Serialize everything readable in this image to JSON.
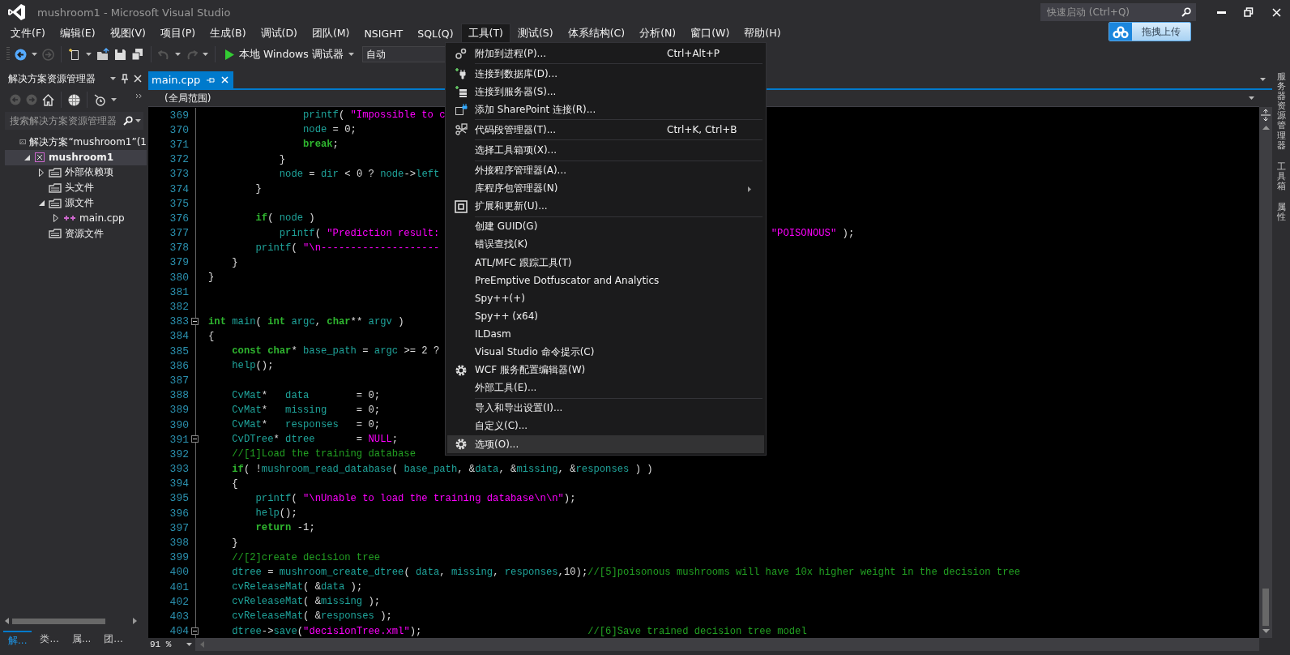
{
  "window": {
    "title": "mushroom1 - Microsoft Visual Studio",
    "quick_launch": {
      "placeholder": "快速启动 (Ctrl+Q)"
    }
  },
  "upload_button": {
    "label": "拖拽上传"
  },
  "menu_bar": [
    {
      "label": "文件(F)",
      "selected": false
    },
    {
      "label": "编辑(E)",
      "selected": false
    },
    {
      "label": "视图(V)",
      "selected": false
    },
    {
      "label": "项目(P)",
      "selected": false
    },
    {
      "label": "生成(B)",
      "selected": false
    },
    {
      "label": "调试(D)",
      "selected": false
    },
    {
      "label": "团队(M)",
      "selected": false
    },
    {
      "label": "NSIGHT",
      "selected": false
    },
    {
      "label": "SQL(Q)",
      "selected": false
    },
    {
      "label": "工具(T)",
      "selected": true
    },
    {
      "label": "测试(S)",
      "selected": false
    },
    {
      "label": "体系结构(C)",
      "selected": false
    },
    {
      "label": "分析(N)",
      "selected": false
    },
    {
      "label": "窗口(W)",
      "selected": false
    },
    {
      "label": "帮助(H)",
      "selected": false
    }
  ],
  "toolbar": {
    "debugger": "本地 Windows 调试器",
    "configuration": "自动"
  },
  "tools_menu": {
    "groups": [
      [
        {
          "label": "附加到进程(P)...",
          "shortcut": "Ctrl+Alt+P",
          "kind": "gears",
          "submenu": false,
          "selected": false
        }
      ],
      [
        {
          "label": "连接到数据库(D)...",
          "kind": "plug",
          "submenu": false,
          "selected": false
        },
        {
          "label": "连接到服务器(S)...",
          "kind": "server",
          "submenu": false,
          "selected": false
        },
        {
          "label": "添加 SharePoint 连接(R)...",
          "kind": "page",
          "submenu": false,
          "selected": false
        }
      ],
      [
        {
          "label": "代码段管理器(T)...",
          "shortcut": "Ctrl+K, Ctrl+B",
          "kind": "scissors",
          "submenu": false,
          "selected": false
        }
      ],
      [
        {
          "label": "选择工具箱项(X)...",
          "kind": "plain",
          "submenu": false,
          "selected": false
        }
      ],
      [
        {
          "label": "外接程序管理器(A)...",
          "kind": "plain",
          "submenu": false,
          "selected": false
        },
        {
          "label": "库程序包管理器(N)",
          "kind": "plain",
          "submenu": true,
          "selected": false
        },
        {
          "label": "扩展和更新(U)...",
          "kind": "blocks",
          "submenu": false,
          "selected": false
        }
      ],
      [
        {
          "label": "创建 GUID(G)",
          "kind": "plain",
          "submenu": false,
          "selected": false
        },
        {
          "label": "错误查找(K)",
          "kind": "plain",
          "submenu": false,
          "selected": false
        },
        {
          "label": "ATL/MFC 跟踪工具(T)",
          "kind": "plain",
          "submenu": false,
          "selected": false
        },
        {
          "label": "PreEmptive Dotfuscator and Analytics",
          "kind": "plain",
          "submenu": false,
          "selected": false
        },
        {
          "label": "Spy++(+)",
          "kind": "plain",
          "submenu": false,
          "selected": false
        },
        {
          "label": "Spy++ (x64)",
          "kind": "plain",
          "submenu": false,
          "selected": false
        },
        {
          "label": "ILDasm",
          "kind": "plain",
          "submenu": false,
          "selected": false
        },
        {
          "label": "Visual Studio 命令提示(C)",
          "kind": "plain",
          "submenu": false,
          "selected": false
        },
        {
          "label": "WCF 服务配置编辑器(W)",
          "kind": "gear",
          "submenu": false,
          "selected": false
        },
        {
          "label": "外部工具(E)...",
          "kind": "plain",
          "submenu": false,
          "selected": false
        }
      ],
      [
        {
          "label": "导入和导出设置(I)...",
          "kind": "plain",
          "submenu": false,
          "selected": false
        },
        {
          "label": "自定义(C)...",
          "kind": "plain",
          "submenu": false,
          "selected": false
        },
        {
          "label": "选项(O)...",
          "kind": "gear",
          "submenu": false,
          "selected": true
        }
      ]
    ]
  },
  "solution_explorer": {
    "title": "解决方案资源管理器",
    "search": {
      "placeholder": "搜索解决方案资源管理器"
    },
    "tree": [
      {
        "label": "解决方案“mushroom1”(1",
        "kind": "solution",
        "expandable": false,
        "selected": false,
        "children": [
          {
            "label": "mushroom1",
            "kind": "project",
            "expandable": true,
            "expanded": true,
            "selected": true,
            "children": [
              {
                "label": "外部依赖项",
                "kind": "folder",
                "expandable": true,
                "expanded": false,
                "selected": false
              },
              {
                "label": "头文件",
                "kind": "folder",
                "expandable": false,
                "selected": false
              },
              {
                "label": "源文件",
                "kind": "folder",
                "expandable": true,
                "expanded": true,
                "selected": false,
                "children": [
                  {
                    "label": "main.cpp",
                    "kind": "cpp",
                    "expandable": true,
                    "expanded": false,
                    "selected": false
                  }
                ]
              },
              {
                "label": "资源文件",
                "kind": "folder",
                "expandable": false,
                "selected": false
              }
            ]
          }
        ]
      }
    ],
    "bottom_tabs": [
      {
        "label": "解...",
        "selected": true
      },
      {
        "label": "类...",
        "selected": false
      },
      {
        "label": "属...",
        "selected": false
      },
      {
        "label": "团...",
        "selected": false
      }
    ]
  },
  "editor": {
    "tab": {
      "label": "main.cpp",
      "selected": true
    },
    "scope": "(全局范围)",
    "zoom": "91 %",
    "lines": [
      {
        "number": "369",
        "fold": false,
        "tokens": [
          {
            "text": "                printf",
            "kind": "id"
          },
          {
            "text": "( ",
            "kind": "p"
          },
          {
            "text": "\"Impossible to c",
            "kind": "str"
          }
        ]
      },
      {
        "number": "370",
        "fold": false,
        "tokens": [
          {
            "text": "                node",
            "kind": "id"
          },
          {
            "text": " = ",
            "kind": "p"
          },
          {
            "text": "0",
            "kind": "num"
          },
          {
            "text": ";",
            "kind": "p"
          }
        ]
      },
      {
        "number": "371",
        "fold": false,
        "tokens": [
          {
            "text": "                break",
            "kind": "kw"
          },
          {
            "text": ";",
            "kind": "p"
          }
        ]
      },
      {
        "number": "372",
        "fold": false,
        "tokens": [
          {
            "text": "            }",
            "kind": "p"
          }
        ]
      },
      {
        "number": "373",
        "fold": false,
        "tokens": [
          {
            "text": "            node",
            "kind": "id"
          },
          {
            "text": " = ",
            "kind": "p"
          },
          {
            "text": "dir",
            "kind": "id"
          },
          {
            "text": " < ",
            "kind": "p"
          },
          {
            "text": "0",
            "kind": "num"
          },
          {
            "text": " ? ",
            "kind": "p"
          },
          {
            "text": "node",
            "kind": "id"
          },
          {
            "text": "->",
            "kind": "p"
          },
          {
            "text": "left",
            "kind": "id"
          }
        ]
      },
      {
        "number": "374",
        "fold": false,
        "tokens": [
          {
            "text": "        }",
            "kind": "p"
          }
        ]
      },
      {
        "number": "375",
        "fold": false
      },
      {
        "number": "376",
        "fold": false,
        "tokens": [
          {
            "text": "        if",
            "kind": "kw"
          },
          {
            "text": "( ",
            "kind": "p"
          },
          {
            "text": "node",
            "kind": "id"
          },
          {
            "text": " )",
            "kind": "p"
          }
        ]
      },
      {
        "number": "377",
        "fold": false,
        "tokens": [
          {
            "text": "            printf",
            "kind": "id"
          },
          {
            "text": "( ",
            "kind": "p"
          },
          {
            "text": "\"Prediction result:",
            "kind": "str"
          }
        ],
        "after_menu": [
          {
            "text": "\"POISONOUS\"",
            "kind": "str"
          },
          {
            "text": " );",
            "kind": "p"
          }
        ]
      },
      {
        "number": "378",
        "fold": false,
        "tokens": [
          {
            "text": "        printf",
            "kind": "id"
          },
          {
            "text": "( ",
            "kind": "p"
          },
          {
            "text": "\"\\n--------------------",
            "kind": "str"
          }
        ]
      },
      {
        "number": "379",
        "fold": false,
        "tokens": [
          {
            "text": "    }",
            "kind": "p"
          }
        ]
      },
      {
        "number": "380",
        "fold": false,
        "tokens": [
          {
            "text": "}",
            "kind": "p"
          }
        ]
      },
      {
        "number": "381",
        "fold": false
      },
      {
        "number": "382",
        "fold": false
      },
      {
        "number": "383",
        "fold": true,
        "tokens": [
          {
            "text": "int",
            "kind": "kw"
          },
          {
            "text": " main",
            "kind": "id"
          },
          {
            "text": "( ",
            "kind": "p"
          },
          {
            "text": "int",
            "kind": "kw"
          },
          {
            "text": " argc",
            "kind": "id"
          },
          {
            "text": ", ",
            "kind": "p"
          },
          {
            "text": "char",
            "kind": "kw"
          },
          {
            "text": "** ",
            "kind": "p"
          },
          {
            "text": "argv",
            "kind": "id"
          },
          {
            "text": " )",
            "kind": "p"
          }
        ]
      },
      {
        "number": "384",
        "fold": false,
        "tokens": [
          {
            "text": "{",
            "kind": "p"
          }
        ]
      },
      {
        "number": "385",
        "fold": false,
        "tokens": [
          {
            "text": "    const",
            "kind": "kw"
          },
          {
            "text": " char",
            "kind": "kw"
          },
          {
            "text": "* ",
            "kind": "p"
          },
          {
            "text": "base_path",
            "kind": "id"
          },
          {
            "text": " = ",
            "kind": "p"
          },
          {
            "text": "argc",
            "kind": "id"
          },
          {
            "text": " >= ",
            "kind": "p"
          },
          {
            "text": "2",
            "kind": "num"
          },
          {
            "text": " ?",
            "kind": "p"
          }
        ]
      },
      {
        "number": "386",
        "fold": false,
        "tokens": [
          {
            "text": "    help",
            "kind": "id"
          },
          {
            "text": "();",
            "kind": "p"
          }
        ]
      },
      {
        "number": "387",
        "fold": false
      },
      {
        "number": "388",
        "fold": false,
        "tokens": [
          {
            "text": "    CvMat",
            "kind": "id"
          },
          {
            "text": "*   ",
            "kind": "p"
          },
          {
            "text": "data",
            "kind": "id"
          },
          {
            "text": "        = ",
            "kind": "p"
          },
          {
            "text": "0",
            "kind": "num"
          },
          {
            "text": ";",
            "kind": "p"
          }
        ]
      },
      {
        "number": "389",
        "fold": false,
        "tokens": [
          {
            "text": "    CvMat",
            "kind": "id"
          },
          {
            "text": "*   ",
            "kind": "p"
          },
          {
            "text": "missing",
            "kind": "id"
          },
          {
            "text": "     = ",
            "kind": "p"
          },
          {
            "text": "0",
            "kind": "num"
          },
          {
            "text": ";",
            "kind": "p"
          }
        ]
      },
      {
        "number": "390",
        "fold": false,
        "tokens": [
          {
            "text": "    CvMat",
            "kind": "id"
          },
          {
            "text": "*   ",
            "kind": "p"
          },
          {
            "text": "responses",
            "kind": "id"
          },
          {
            "text": "   = ",
            "kind": "p"
          },
          {
            "text": "0",
            "kind": "num"
          },
          {
            "text": ";",
            "kind": "p"
          }
        ]
      },
      {
        "number": "391",
        "fold": true,
        "tokens": [
          {
            "text": "    CvDTree",
            "kind": "id"
          },
          {
            "text": "* ",
            "kind": "p"
          },
          {
            "text": "dtree",
            "kind": "id"
          },
          {
            "text": "       = ",
            "kind": "p"
          },
          {
            "text": "NULL",
            "kind": "str"
          },
          {
            "text": ";",
            "kind": "p"
          }
        ]
      },
      {
        "number": "392",
        "fold": false,
        "tokens": [
          {
            "text": "    //[1]Load the training database",
            "kind": "cmt"
          }
        ]
      },
      {
        "number": "393",
        "fold": false,
        "tokens": [
          {
            "text": "    if",
            "kind": "kw"
          },
          {
            "text": "( !",
            "kind": "p"
          },
          {
            "text": "mushroom_read_database",
            "kind": "id"
          },
          {
            "text": "( ",
            "kind": "p"
          },
          {
            "text": "base_path",
            "kind": "id"
          },
          {
            "text": ", &",
            "kind": "p"
          },
          {
            "text": "data",
            "kind": "id"
          },
          {
            "text": ", &",
            "kind": "p"
          },
          {
            "text": "missing",
            "kind": "id"
          },
          {
            "text": ", &",
            "kind": "p"
          },
          {
            "text": "responses",
            "kind": "id"
          },
          {
            "text": " ) )",
            "kind": "p"
          }
        ]
      },
      {
        "number": "394",
        "fold": false,
        "tokens": [
          {
            "text": "    {",
            "kind": "p"
          }
        ]
      },
      {
        "number": "395",
        "fold": false,
        "tokens": [
          {
            "text": "        printf",
            "kind": "id"
          },
          {
            "text": "( ",
            "kind": "p"
          },
          {
            "text": "\"\\nUnable to load the training database\\n\\n\"",
            "kind": "str"
          },
          {
            "text": ");",
            "kind": "p"
          }
        ]
      },
      {
        "number": "396",
        "fold": false,
        "tokens": [
          {
            "text": "        help",
            "kind": "id"
          },
          {
            "text": "();",
            "kind": "p"
          }
        ]
      },
      {
        "number": "397",
        "fold": false,
        "tokens": [
          {
            "text": "        return",
            "kind": "kw"
          },
          {
            "text": " -",
            "kind": "p"
          },
          {
            "text": "1",
            "kind": "num"
          },
          {
            "text": ";",
            "kind": "p"
          }
        ]
      },
      {
        "number": "398",
        "fold": false,
        "tokens": [
          {
            "text": "    }",
            "kind": "p"
          }
        ]
      },
      {
        "number": "399",
        "fold": false,
        "tokens": [
          {
            "text": "    //[2]create decision tree",
            "kind": "cmt"
          }
        ]
      },
      {
        "number": "400",
        "fold": false,
        "tokens": [
          {
            "text": "    dtree",
            "kind": "id"
          },
          {
            "text": " = ",
            "kind": "p"
          },
          {
            "text": "mushroom_create_dtree",
            "kind": "id"
          },
          {
            "text": "( ",
            "kind": "p"
          },
          {
            "text": "data",
            "kind": "id"
          },
          {
            "text": ", ",
            "kind": "p"
          },
          {
            "text": "missing",
            "kind": "id"
          },
          {
            "text": ", ",
            "kind": "p"
          },
          {
            "text": "responses",
            "kind": "id"
          },
          {
            "text": ",",
            "kind": "p"
          },
          {
            "text": "10",
            "kind": "num"
          },
          {
            "text": ");",
            "kind": "p"
          },
          {
            "text": "//[5]poisonous mushrooms will have 10x higher weight in the decision tree",
            "kind": "cmt"
          }
        ]
      },
      {
        "number": "401",
        "fold": false,
        "tokens": [
          {
            "text": "    cvReleaseMat",
            "kind": "id"
          },
          {
            "text": "( &",
            "kind": "p"
          },
          {
            "text": "data",
            "kind": "id"
          },
          {
            "text": " );",
            "kind": "p"
          }
        ]
      },
      {
        "number": "402",
        "fold": false,
        "tokens": [
          {
            "text": "    cvReleaseMat",
            "kind": "id"
          },
          {
            "text": "( &",
            "kind": "p"
          },
          {
            "text": "missing",
            "kind": "id"
          },
          {
            "text": " );",
            "kind": "p"
          }
        ]
      },
      {
        "number": "403",
        "fold": false,
        "tokens": [
          {
            "text": "    cvReleaseMat",
            "kind": "id"
          },
          {
            "text": "( &",
            "kind": "p"
          },
          {
            "text": "responses",
            "kind": "id"
          },
          {
            "text": " );",
            "kind": "p"
          }
        ]
      },
      {
        "number": "404",
        "fold": true,
        "tokens": [
          {
            "text": "    dtree",
            "kind": "id"
          },
          {
            "text": "->",
            "kind": "p"
          },
          {
            "text": "save",
            "kind": "id"
          },
          {
            "text": "(",
            "kind": "p"
          },
          {
            "text": "\"decisionTree.xml\"",
            "kind": "str"
          },
          {
            "text": ");                            ",
            "kind": "p"
          },
          {
            "text": "//[6]Save trained decision tree model",
            "kind": "cmt"
          }
        ]
      }
    ]
  },
  "side_tabs": [
    {
      "label": "服务器资源管理器"
    },
    {
      "label": "工具箱"
    },
    {
      "label": "属性"
    }
  ]
}
